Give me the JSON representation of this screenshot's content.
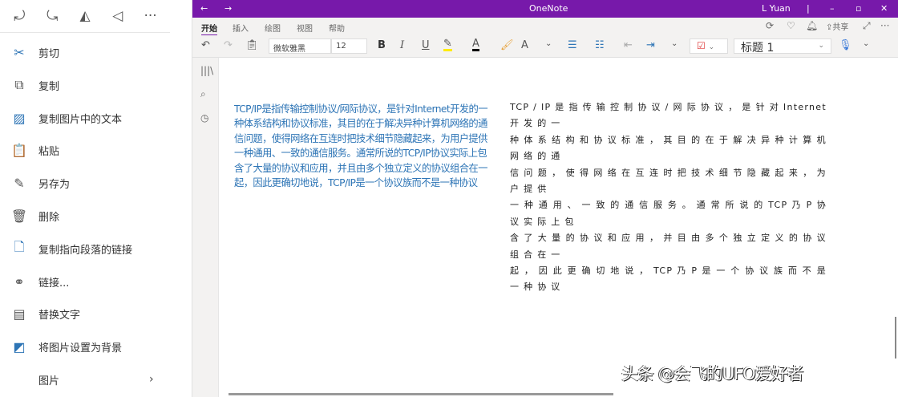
{
  "context_menu": {
    "top_icons": [
      "rotate-right-icon",
      "rotate-left-icon",
      "flip-horizontal-icon",
      "flip-vertical-icon",
      "more-icon"
    ],
    "more_label": "···",
    "items": [
      {
        "label": "剪切",
        "icon": "scissors-icon"
      },
      {
        "label": "复制",
        "icon": "copy-icon"
      },
      {
        "label": "复制图片中的文本",
        "icon": "image-text-icon"
      },
      {
        "label": "粘贴",
        "icon": "paste-icon"
      },
      {
        "label": "另存为",
        "icon": "save-as-icon"
      },
      {
        "label": "删除",
        "icon": "trash-icon"
      },
      {
        "label": "复制指向段落的链接",
        "icon": "link-page-icon"
      },
      {
        "label": "链接...",
        "icon": "link-icon"
      },
      {
        "label": "替换文字",
        "icon": "alt-text-icon"
      },
      {
        "label": "将图片设置为背景",
        "icon": "background-image-icon"
      },
      {
        "label": "图片",
        "icon": "",
        "has_submenu": true
      }
    ]
  },
  "titlebar": {
    "app": "OneNote",
    "user": "L Yuan"
  },
  "tabs": [
    "开始",
    "插入",
    "绘图",
    "视图",
    "帮助"
  ],
  "share_label": "共享",
  "toolbar": {
    "font": "微软雅黑",
    "size": "12",
    "style": "标题 1"
  },
  "colors": {
    "accent": "#7719aa",
    "link_text": "#2e75b6"
  },
  "content": {
    "blue_text": "TCP/IP是指传输控制协议/网际协议，是针对Internet开发的一种体系结构和协议标准，其目的在于解决异种计算机网络的通信问题，使得网络在互连时把技术细节隐藏起来，为用户提供一种通用、一致的通信服务。通常所说的TCP/IP协议实际上包含了大量的协议和应用，并且由多个独立定义的协议组合在一起，因此更确切地说，TCP/IP是一个协议族而不是一种协议",
    "ocr_lines": [
      "TCP / IP 是 指 传 输 控 制 协 议 / 网 际 协 议 ， 是 针 对 Internet 开 发 的 一",
      "种 体 系 结 构 和 协 议 标 准 ， 其 目 的 在 于 解 决 异 种 计 算 机 网 络 的 通",
      "信 问 题 ， 使 得 网 络 在 互 连 时 把 技 术 细 节 隐 藏 起 来 ， 为 户 提 供",
      "一 种 通 用 、 一 致 的 通 信 服 务 。 通 常 所 说 的 TCP 乃 P 协 议 实 际 上 包",
      "含 了 大 量 的 协 议 和 应 用 ， 并 目 由 多 个 独 立 定 义 的 协 议 组 合 在 一",
      "起 ， 因 此 更 确 切 地 说 ， TCP 乃 P 是 一 个 协 议 族 而 不 是 一 种 协 议"
    ]
  },
  "watermark": "头条 @会飞的UFO爱好者"
}
